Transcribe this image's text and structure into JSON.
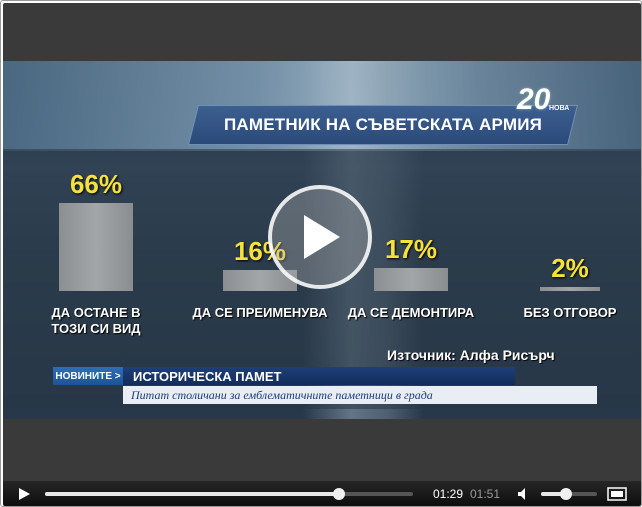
{
  "video": {
    "logo_text": "20",
    "logo_sub": "НОВА",
    "graphic_title": "ПАМЕТНИК НА СЪВЕТСКАТА АРМИЯ",
    "source": "Източник: Алфа Рисърч",
    "news_tag": "НОВИНИТЕ >",
    "headline": "ИСТОРИЧЕСКА ПАМЕТ",
    "subline": "Питат столичани за емблематичните паметници в града"
  },
  "chart_data": {
    "type": "bar",
    "title": "ПАМЕТНИК НА СЪВЕТСКАТА АРМИЯ",
    "categories": [
      "ДА ОСТАНЕ В ТОЗИ СИ ВИД",
      "ДА СЕ ПРЕИМЕНУВА",
      "ДА СЕ ДЕМОНТИРА",
      "БЕЗ ОТГОВОР"
    ],
    "category_lines": [
      [
        "ДА ОСТАНЕ В",
        "ТОЗИ СИ ВИД"
      ],
      [
        "ДА СЕ ПРЕИМЕНУВА"
      ],
      [
        "ДА СЕ ДЕМОНТИРА"
      ],
      [
        "БЕЗ ОТГОВОР"
      ]
    ],
    "values": [
      66,
      16,
      17,
      2
    ],
    "value_labels": [
      "66%",
      "16%",
      "17%",
      "2%"
    ],
    "unit": "%",
    "ylim": [
      0,
      66
    ],
    "grid": false,
    "legend": "none",
    "colors": {
      "bar": "#9a9da0",
      "value_label": "#f7e23b"
    }
  },
  "player": {
    "current_time": "01:29",
    "duration": "01:51",
    "progress": 0.8,
    "volume": 0.45,
    "colors": {
      "bar_bg": "#1a1a1a",
      "accent": "#ffffff"
    },
    "icons": {
      "play": "play-icon",
      "volume": "volume-icon",
      "fullscreen": "fullscreen-icon",
      "overlay": "play-overlay-icon"
    }
  }
}
